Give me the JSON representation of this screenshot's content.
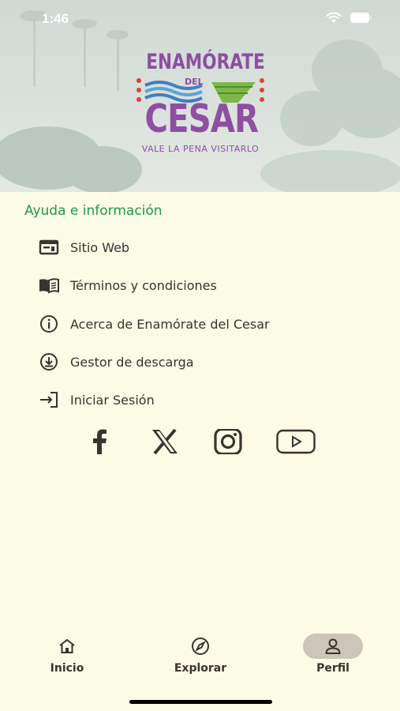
{
  "status_bar": {
    "time": "1:46"
  },
  "header": {
    "logo": {
      "line1": "ENAMÓRATE",
      "line2": "DEL",
      "line3": "CESAR",
      "tagline": "VALE LA PENA VISITARLO"
    }
  },
  "section": {
    "title": "Ayuda e información",
    "items": [
      {
        "label": "Sitio Web",
        "icon": "website-icon"
      },
      {
        "label": "Términos y condiciones",
        "icon": "book-icon"
      },
      {
        "label": "Acerca de Enamórate del Cesar",
        "icon": "info-icon"
      },
      {
        "label": "Gestor de descarga",
        "icon": "download-icon"
      },
      {
        "label": "Iniciar Sesión",
        "icon": "login-icon"
      }
    ]
  },
  "socials": [
    "facebook-icon",
    "x-icon",
    "instagram-icon",
    "youtube-icon"
  ],
  "bottom_nav": {
    "items": [
      {
        "label": "Inicio",
        "icon": "home-icon",
        "active": false
      },
      {
        "label": "Explorar",
        "icon": "compass-icon",
        "active": false
      },
      {
        "label": "Perfil",
        "icon": "person-icon",
        "active": true
      }
    ]
  },
  "colors": {
    "background": "#fcfbe6",
    "accent_green": "#1e9a4a",
    "logo_purple": "#8d4fa0",
    "text": "#3a332f",
    "active_pill": "#ccc6b8"
  }
}
